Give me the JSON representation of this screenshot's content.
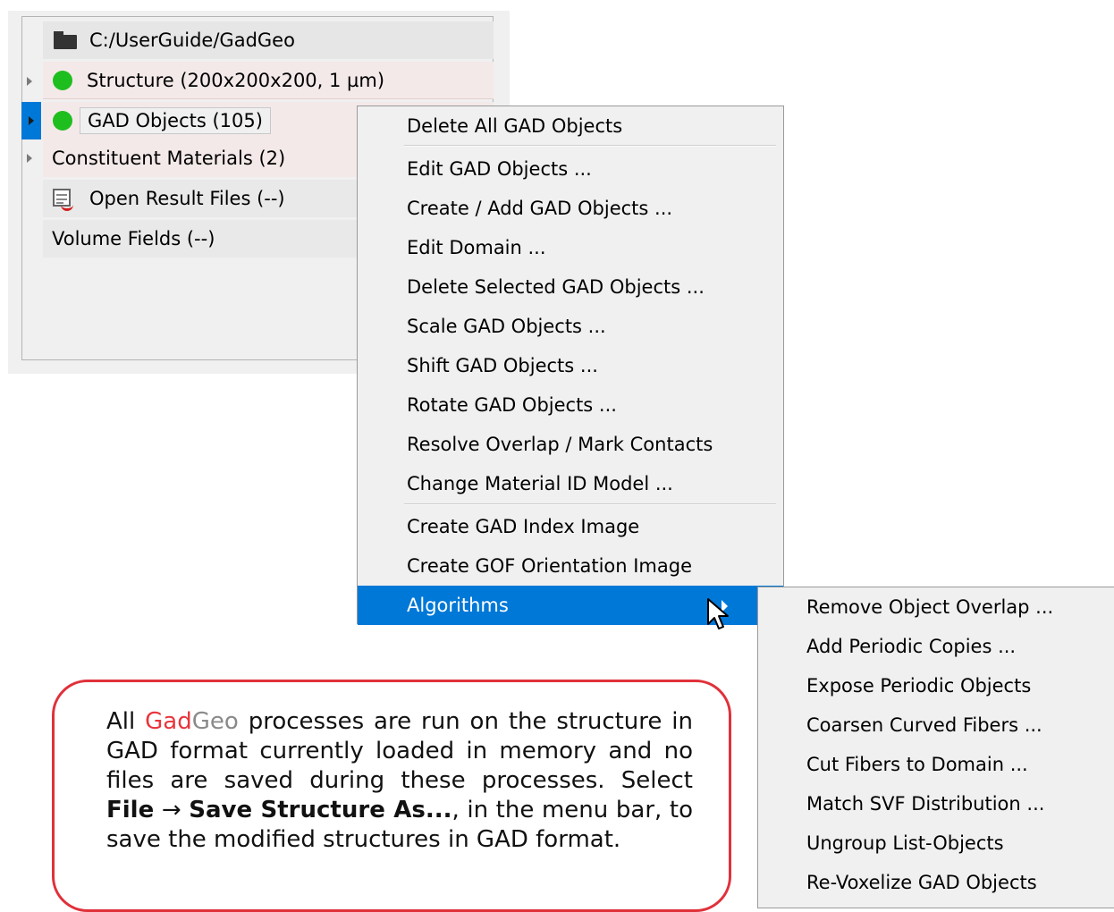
{
  "tree": {
    "path": "C:/UserGuide/GadGeo",
    "structure": "Structure (200x200x200, 1 µm)",
    "gad_objects": "GAD Objects (105)",
    "constituent": "Constituent Materials (2)",
    "results": "Open Result Files (--)",
    "volume": "Volume Fields (--)"
  },
  "context_menu": {
    "items": [
      "Delete All GAD Objects",
      "Edit GAD Objects ...",
      "Create / Add GAD Objects ...",
      "Edit Domain ...",
      "Delete Selected GAD Objects ...",
      "Scale GAD Objects ...",
      "Shift GAD Objects ...",
      "Rotate GAD Objects ...",
      "Resolve Overlap / Mark Contacts",
      "Change Material ID Model ...",
      "Create GAD Index Image",
      "Create GOF Orientation Image",
      "Algorithms"
    ]
  },
  "submenu": {
    "items": [
      "Remove Object Overlap ...",
      "Add Periodic Copies ...",
      "Expose Periodic Objects",
      "Coarsen Curved Fibers ...",
      "Cut Fibers to Domain ...",
      "Match SVF Distribution ...",
      "Ungroup List-Objects",
      "Re-Voxelize GAD Objects"
    ]
  },
  "note": {
    "all": "All ",
    "gad": "Gad",
    "geo": "Geo",
    "text1": " processes are run on the structure in GAD format currently loaded in memory and no files are saved during these processes. Select ",
    "file": "File",
    "arrow": " → ",
    "save_as": "Save Structure As...",
    "text2": ", in the menu bar, to save the modified structures in GAD format."
  },
  "colors": {
    "selection": "#0078d7",
    "status_green": "#1ebe1e",
    "note_border": "#e0313a",
    "gad_red": "#e8353d"
  }
}
